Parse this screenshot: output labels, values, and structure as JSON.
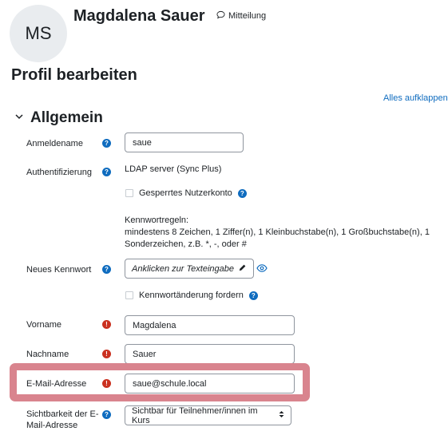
{
  "header": {
    "avatar_initials": "MS",
    "user_name": "Magdalena Sauer",
    "message_label": "Mitteilung"
  },
  "page": {
    "title": "Profil bearbeiten",
    "expand_all": "Alles aufklappen"
  },
  "section": {
    "title": "Allgemein"
  },
  "fields": {
    "username": {
      "label": "Anmeldename",
      "value": "saue"
    },
    "auth": {
      "label": "Authentifizierung",
      "value": "LDAP server (Sync Plus)"
    },
    "suspended": {
      "label": "Gesperrtes Nutzerkonto"
    },
    "password_rules": {
      "heading": "Kennwortregeln:",
      "line1": "mindestens 8 Zeichen, 1 Ziffer(n), 1 Kleinbuchstabe(n), 1 Großbuchstabe(n), 1",
      "line2": "Sonderzeichen, z.B. *, -, oder #"
    },
    "new_password": {
      "label": "Neues Kennwort",
      "placeholder": "Anklicken zur Texteingabe"
    },
    "force_change": {
      "label": "Kennwortänderung fordern"
    },
    "firstname": {
      "label": "Vorname",
      "value": "Magdalena"
    },
    "lastname": {
      "label": "Nachname",
      "value": "Sauer"
    },
    "email": {
      "label": "E-Mail-Adresse",
      "value": "saue@schule.local"
    },
    "email_visibility": {
      "label_line1": "Sichtbarkeit der E-",
      "label_line2": "Mail-Adresse",
      "value": "Sichtbar für Teilnehmer/innen im Kurs"
    }
  },
  "colors": {
    "accent": "#0f6cbf",
    "required": "#ca3120",
    "highlight": "#d9848e"
  },
  "icons": {
    "help": "question-circle-icon",
    "required": "exclamation-circle-icon",
    "message": "speech-bubble-icon",
    "edit": "pencil-icon",
    "reveal": "eye-icon",
    "section_toggle": "chevron-down-icon",
    "select": "up-down-arrows-icon"
  }
}
